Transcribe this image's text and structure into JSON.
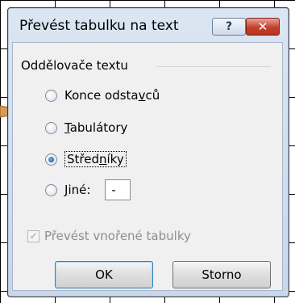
{
  "dialog": {
    "title": "Převést tabulku na text",
    "help_glyph": "?",
    "close_glyph": "✕"
  },
  "group": {
    "label": "Oddělovače textu"
  },
  "options": {
    "konce": {
      "pre": "Konce odsta",
      "u": "v",
      "post": "ců",
      "checked": false
    },
    "tab": {
      "pre": "",
      "u": "T",
      "post": "abulátory",
      "checked": false
    },
    "stred": {
      "pre": "Střed",
      "u": "n",
      "post": "íky",
      "checked": true
    },
    "jine": {
      "pre": "",
      "u": "J",
      "post": "iné:",
      "checked": false,
      "value": "-"
    }
  },
  "nested": {
    "label": "Převést vnořené tabulky",
    "checked": true,
    "enabled": false,
    "check_glyph": "✓"
  },
  "buttons": {
    "ok": "OK",
    "cancel": "Storno"
  },
  "colors": {
    "frame": "#8a1a10",
    "close": "#c4412c",
    "arrow": "#d99a52"
  }
}
